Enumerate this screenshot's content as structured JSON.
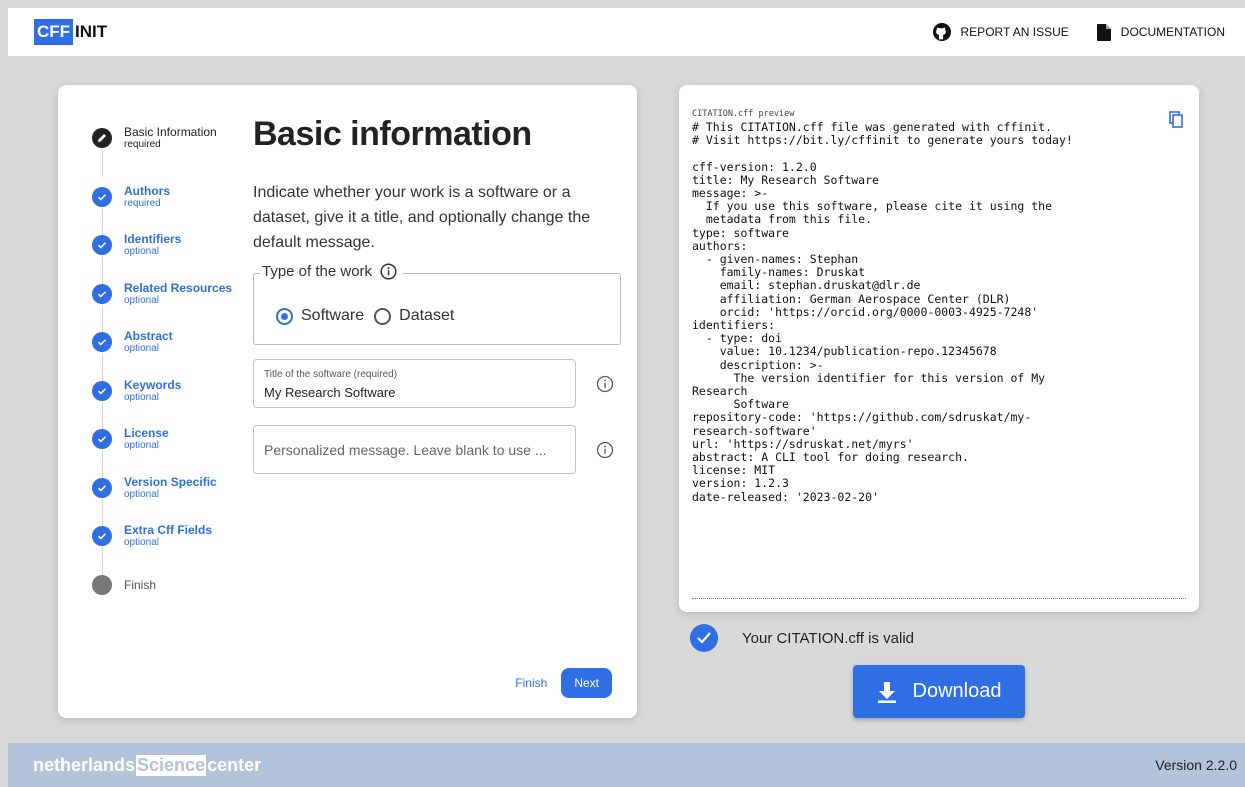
{
  "header": {
    "logo_cff": "CFF",
    "logo_init": "INIT",
    "report_label": "REPORT AN ISSUE",
    "docs_label": "DOCUMENTATION"
  },
  "stepper": {
    "steps": [
      {
        "title": "Basic Information",
        "sub": "required"
      },
      {
        "title": "Authors",
        "sub": "required"
      },
      {
        "title": "Identifiers",
        "sub": "optional"
      },
      {
        "title": "Related Resources",
        "sub": "optional"
      },
      {
        "title": "Abstract",
        "sub": "optional"
      },
      {
        "title": "Keywords",
        "sub": "optional"
      },
      {
        "title": "License",
        "sub": "optional"
      },
      {
        "title": "Version Specific",
        "sub": "optional"
      },
      {
        "title": "Extra Cff Fields",
        "sub": "optional"
      },
      {
        "title": "Finish",
        "sub": ""
      }
    ]
  },
  "form": {
    "heading": "Basic information",
    "description": "Indicate whether your work is a software or a dataset, give it a title, and optionally change the default message.",
    "type_legend": "Type of the work",
    "radio_software": "Software",
    "radio_dataset": "Dataset",
    "title_label": "Title of the software (required)",
    "title_value": "My Research Software",
    "message_placeholder": "Personalized message. Leave blank to use ..."
  },
  "actions": {
    "finish_label": "Finish",
    "next_label": "Next"
  },
  "preview": {
    "label": "CITATION.cff preview",
    "code": "# This CITATION.cff file was generated with cffinit.\n# Visit https://bit.ly/cffinit to generate yours today!\n\ncff-version: 1.2.0\ntitle: My Research Software\nmessage: >-\n  If you use this software, please cite it using the\n  metadata from this file.\ntype: software\nauthors:\n  - given-names: Stephan\n    family-names: Druskat\n    email: stephan.druskat@dlr.de\n    affiliation: German Aerospace Center (DLR)\n    orcid: 'https://orcid.org/0000-0003-4925-7248'\nidentifiers:\n  - type: doi\n    value: 10.1234/publication-repo.12345678\n    description: >-\n      The version identifier for this version of My\nResearch\n      Software\nrepository-code: 'https://github.com/sdruskat/my-\nresearch-software'\nurl: 'https://sdruskat.net/myrs'\nabstract: A CLI tool for doing research.\nlicense: MIT\nversion: 1.2.3\ndate-released: '2023-02-20'",
    "valid_text": "Your CITATION.cff is valid",
    "download_label": "Download"
  },
  "footer": {
    "brand_pre": "netherlands",
    "brand_sci": "Science",
    "brand_post": "center",
    "version": "Version 2.2.0"
  },
  "colors": {
    "accent": "#2f6fe3",
    "footer_bg": "#b3c3da",
    "page_bg": "#d9d9d9"
  }
}
